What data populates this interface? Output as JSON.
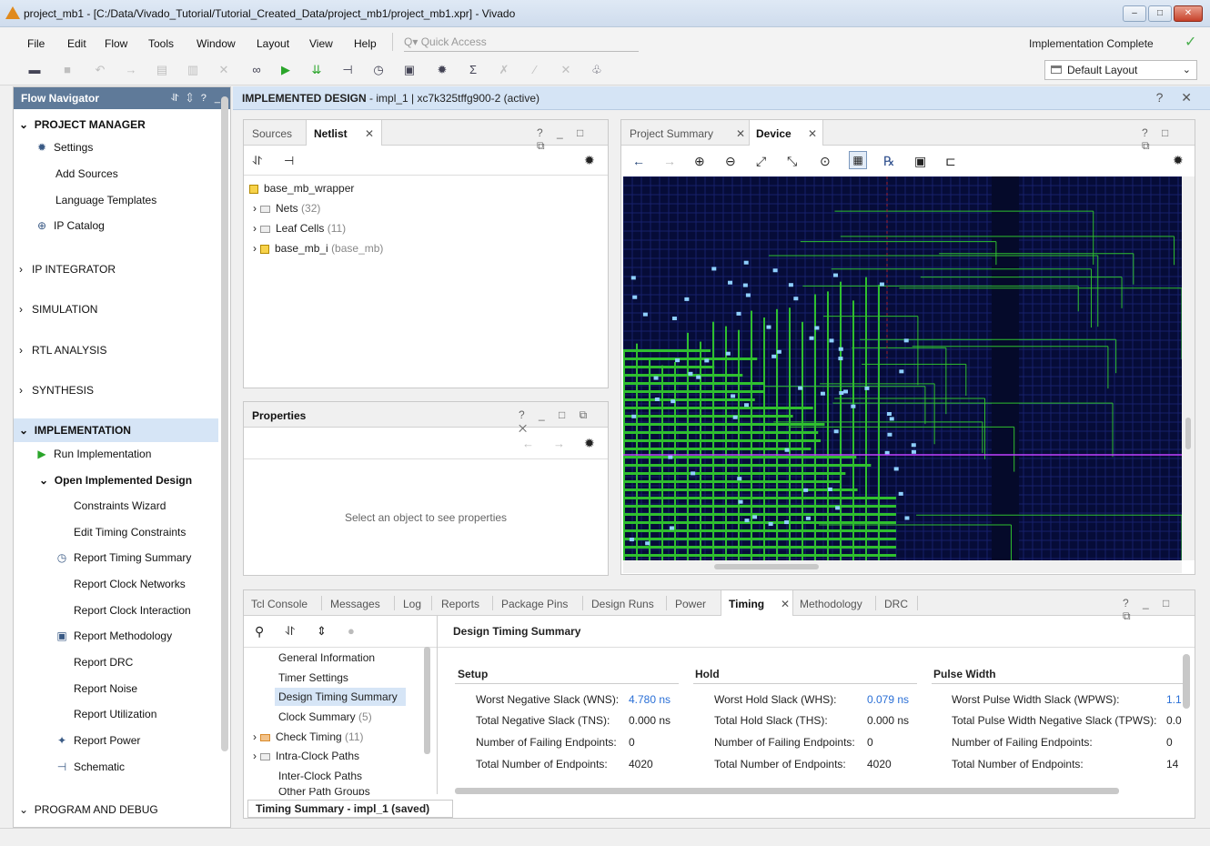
{
  "window": {
    "title": "project_mb1 - [C:/Data/Vivado_Tutorial/Tutorial_Created_Data/project_mb1/project_mb1.xpr] - Vivado",
    "min": "–",
    "max": "□",
    "close": "✕"
  },
  "menu": {
    "items": [
      "File",
      "Edit",
      "Flow",
      "Tools",
      "Window",
      "Layout",
      "View",
      "Help"
    ],
    "quick_access": "Q▾ Quick Access",
    "status": "Implementation Complete",
    "status_check": "✓"
  },
  "toolbar": {
    "layout_select": "Default Layout",
    "chevron": "⌄"
  },
  "flow_navigator": {
    "title": "Flow Navigator",
    "tools": "⥯ ⇕ ? _",
    "sections": {
      "project_manager": "PROJECT MANAGER",
      "settings": "Settings",
      "add_sources": "Add Sources",
      "language_templates": "Language Templates",
      "ip_catalog": "IP Catalog",
      "ip_integrator": "IP INTEGRATOR",
      "simulation": "SIMULATION",
      "rtl_analysis": "RTL ANALYSIS",
      "synthesis": "SYNTHESIS",
      "implementation": "IMPLEMENTATION",
      "run_implementation": "Run Implementation",
      "open_implemented_design": "Open Implemented Design",
      "constraints_wizard": "Constraints Wizard",
      "edit_timing_constraints": "Edit Timing Constraints",
      "report_timing_summary": "Report Timing Summary",
      "report_clock_networks": "Report Clock Networks",
      "report_clock_interaction": "Report Clock Interaction",
      "report_methodology": "Report Methodology",
      "report_drc": "Report DRC",
      "report_noise": "Report Noise",
      "report_utilization": "Report Utilization",
      "report_power": "Report Power",
      "schematic": "Schematic",
      "program_and_debug": "PROGRAM AND DEBUG"
    }
  },
  "impl_header": {
    "label": "IMPLEMENTED DESIGN",
    "detail": " - impl_1 | xc7k325tffg900-2  (active)",
    "tools": "? ✕"
  },
  "sources_panel": {
    "tab_sources": "Sources",
    "tab_netlist": "Netlist",
    "tab_close": "✕",
    "tools": "? _ □ ⧉",
    "root": "base_mb_wrapper",
    "nets": "Nets",
    "nets_count": "(32)",
    "leaf_cells": "Leaf Cells",
    "leaf_cells_count": "(11)",
    "base_mb_i": "base_mb_i",
    "base_mb_i_ref": "(base_mb)"
  },
  "properties_panel": {
    "title": "Properties",
    "tools": "? _ □ ⧉ ✕",
    "empty_msg": "Select an object to see properties"
  },
  "device_panel": {
    "tab_summary": "Project Summary",
    "tab_device": "Device",
    "tab_close": "✕",
    "tools": "? □ ⧉"
  },
  "bottom_panel": {
    "tabs": [
      "Tcl Console",
      "Messages",
      "Log",
      "Reports",
      "Package Pins",
      "Design Runs",
      "Power",
      "Timing",
      "Methodology",
      "DRC"
    ],
    "timing_close": "✕",
    "tools": "? _ □ ⧉",
    "tree": {
      "general_information": "General Information",
      "timer_settings": "Timer Settings",
      "design_timing_summary": "Design Timing Summary",
      "clock_summary": "Clock Summary",
      "clock_summary_count": "(5)",
      "check_timing": "Check Timing",
      "check_timing_count": "(11)",
      "intra_clock_paths": "Intra-Clock Paths",
      "inter_clock_paths": "Inter-Clock Paths",
      "other_path_groups": "Other Path Groups"
    },
    "status_tab": "Timing Summary - impl_1 (saved)",
    "summary_title": "Design Timing Summary",
    "setup": {
      "title": "Setup",
      "wns_label": "Worst Negative Slack (WNS):",
      "wns": "4.780 ns",
      "tns_label": "Total Negative Slack (TNS):",
      "tns": "0.000 ns",
      "fail_label": "Number of Failing Endpoints:",
      "fail": "0",
      "total_label": "Total Number of Endpoints:",
      "total": "4020"
    },
    "hold": {
      "title": "Hold",
      "whs_label": "Worst Hold Slack (WHS):",
      "whs": "0.079 ns",
      "ths_label": "Total Hold Slack (THS):",
      "ths": "0.000 ns",
      "fail_label": "Number of Failing Endpoints:",
      "fail": "0",
      "total_label": "Total Number of Endpoints:",
      "total": "4020"
    },
    "pulse": {
      "title": "Pulse Width",
      "wpws_label": "Worst Pulse Width Slack (WPWS):",
      "wpws": "1.1",
      "tpws_label": "Total Pulse Width Negative Slack (TPWS):",
      "tpws": "0.0",
      "fail_label": "Number of Failing Endpoints:",
      "fail": "0",
      "total_label": "Total Number of Endpoints:",
      "total": "14"
    }
  },
  "colors": {
    "accent": "#5f7a99",
    "link": "#2a6fd6",
    "device_bg": "#060c38",
    "route_green": "#2fbf2f"
  }
}
